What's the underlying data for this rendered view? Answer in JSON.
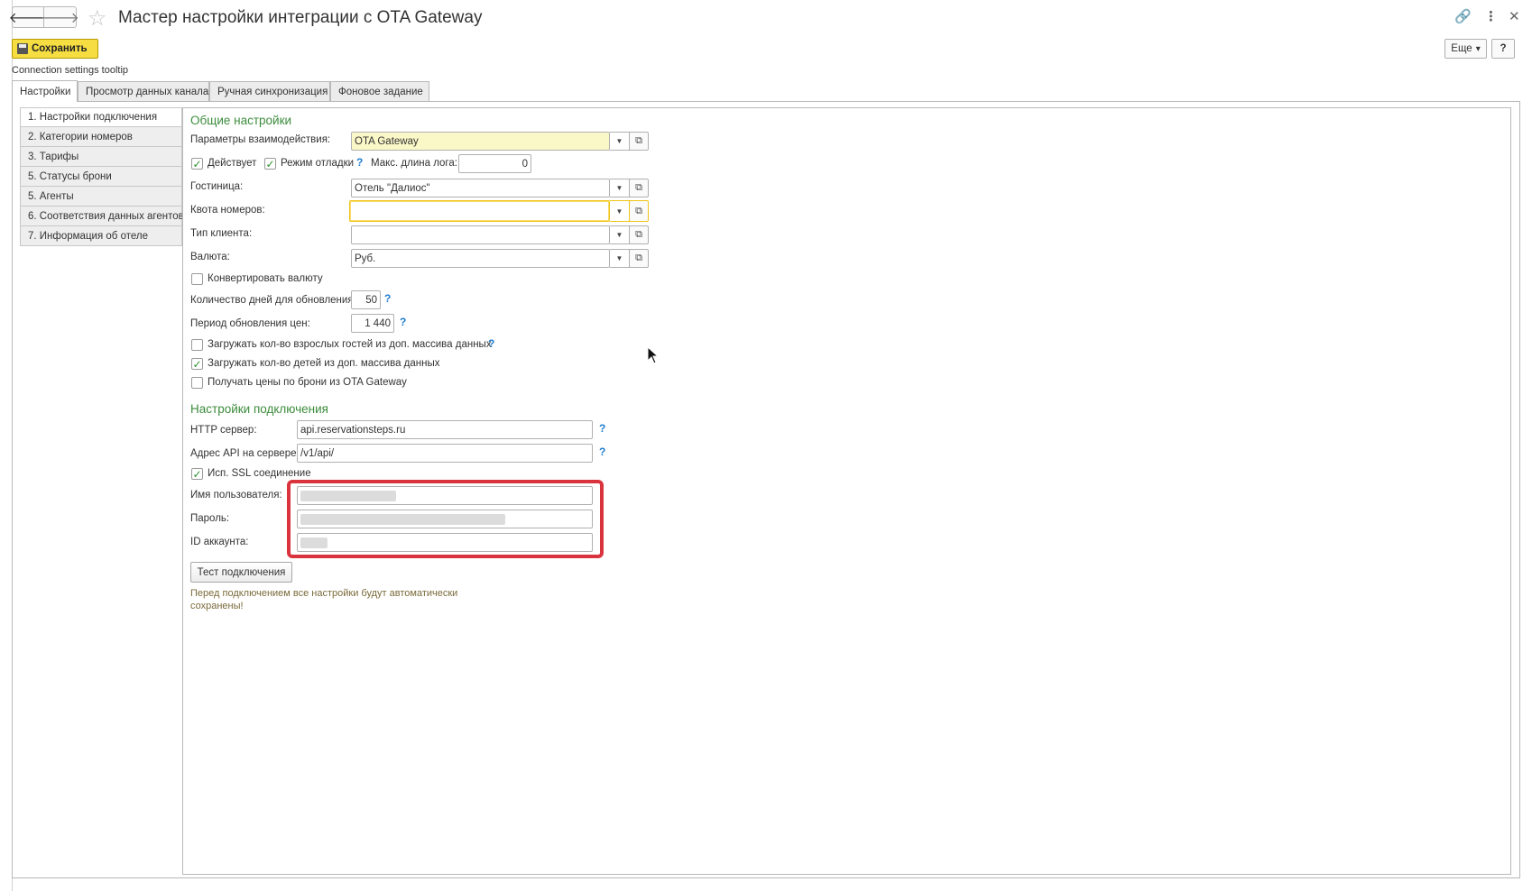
{
  "window": {
    "title": "Мастер настройки интеграции с OTA Gateway",
    "back_icon": "🡐",
    "forward_icon": "🡒",
    "link_icon": "🔗",
    "menu_icon": "⋮",
    "close_icon": "✕",
    "star_icon": "☆"
  },
  "toolbar": {
    "save_label": "Сохранить",
    "more_label": "Еще",
    "help_label": "?"
  },
  "tooltip_text": "Connection settings tooltip",
  "tabs": [
    {
      "label": "Настройки"
    },
    {
      "label": "Просмотр данных канала"
    },
    {
      "label": "Ручная синхронизация"
    },
    {
      "label": "Фоновое задание"
    }
  ],
  "nav": [
    {
      "label": "1. Настройки подключения"
    },
    {
      "label": "2. Категории номеров"
    },
    {
      "label": "3. Тарифы"
    },
    {
      "label": "5. Статусы брони"
    },
    {
      "label": "5. Агенты"
    },
    {
      "label": "6. Соответствия данных агентов"
    },
    {
      "label": "7. Информация об отеле"
    }
  ],
  "general": {
    "title": "Общие настройки",
    "params_label": "Параметры взаимодействия:",
    "params_value": "OTA Gateway",
    "active_label": "Действует",
    "debug_label": "Режим отладки",
    "log_len_label": "Макс. длина лога:",
    "log_len_value": "0",
    "hotel_label": "Гостиница:",
    "hotel_value": "Отель \"Далиос\"",
    "quota_label": "Квота номеров:",
    "quota_value": "",
    "client_type_label": "Тип клиента:",
    "client_type_value": "",
    "currency_label": "Валюта:",
    "currency_value": "Руб.",
    "convert_label": "Конвертировать валюту",
    "days_label": "Количество дней для обновления:",
    "days_value": "50",
    "period_label": "Период обновления цен:",
    "period_value": "1 440",
    "load_adults_label": "Загружать кол-во взрослых гостей из доп. массива данных",
    "load_children_label": "Загружать кол-во детей из доп. массива данных",
    "get_prices_label": "Получать цены по брони из OTA Gateway"
  },
  "connection": {
    "title": "Настройки подключения",
    "http_label": "HTTP сервер:",
    "http_value": "api.reservationsteps.ru",
    "api_label": "Адрес API на сервере:",
    "api_value": "/v1/api/",
    "ssl_label": "Исп. SSL соединение",
    "user_label": "Имя пользователя:",
    "password_label": "Пароль:",
    "account_label": "ID аккаунта:",
    "test_button": "Тест подключения",
    "note": "Перед подключением все настройки будут автоматически сохранены!"
  },
  "symbols": {
    "hint": "?",
    "dropdown": "▼",
    "open": "⧉",
    "check": "✓",
    "more_arrow": "▾"
  },
  "colors": {
    "accent_yellow": "#f5dd42",
    "section_green": "#3c8c3c",
    "hint_blue": "#1f7ecf",
    "highlight_red": "#d9343e"
  }
}
